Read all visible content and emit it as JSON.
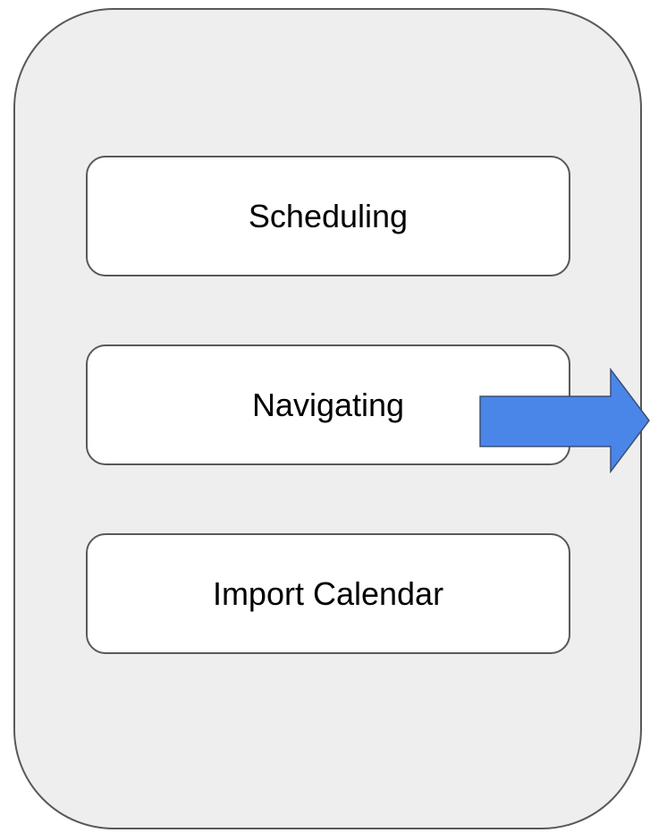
{
  "menu": {
    "items": [
      {
        "label": "Scheduling"
      },
      {
        "label": "Navigating"
      },
      {
        "label": "Import Calendar"
      }
    ]
  },
  "arrow": {
    "icon": "right-arrow-icon",
    "color": "#4a86e8",
    "points_to": "Navigating"
  },
  "colors": {
    "panel_background": "#eeeeee",
    "border": "#595959",
    "button_background": "#ffffff",
    "text": "#000000"
  }
}
